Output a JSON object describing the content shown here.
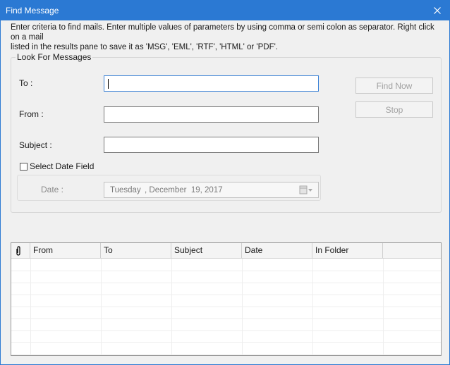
{
  "window": {
    "title": "Find Message",
    "close_icon": "close-icon",
    "accent_color": "#2b79d3"
  },
  "instructions": {
    "line1": "Enter criteria to find mails. Enter multiple values of parameters by using comma or semi colon as separator. Right click on a mail",
    "line2": "listed in the results pane to save it as 'MSG', 'EML', 'RTF', 'HTML' or 'PDF'."
  },
  "search_group": {
    "legend": "Look For Messages",
    "to_label": "To :",
    "to_value": "",
    "from_label": "From :",
    "from_value": "",
    "subject_label": "Subject :",
    "subject_value": "",
    "date_checkbox_label": "Select Date Field",
    "date_checkbox_checked": false,
    "date_label": "Date :",
    "date_weekday": "Tuesday",
    "date_rest": ", December  19, 2017",
    "calendar_icon": "calendar-dropdown-icon"
  },
  "buttons": {
    "find_now": "Find Now",
    "stop": "Stop"
  },
  "results_grid": {
    "attachment_icon": "paperclip-icon",
    "columns": [
      "From",
      "To",
      "Subject",
      "Date",
      "In Folder"
    ],
    "rows": []
  }
}
